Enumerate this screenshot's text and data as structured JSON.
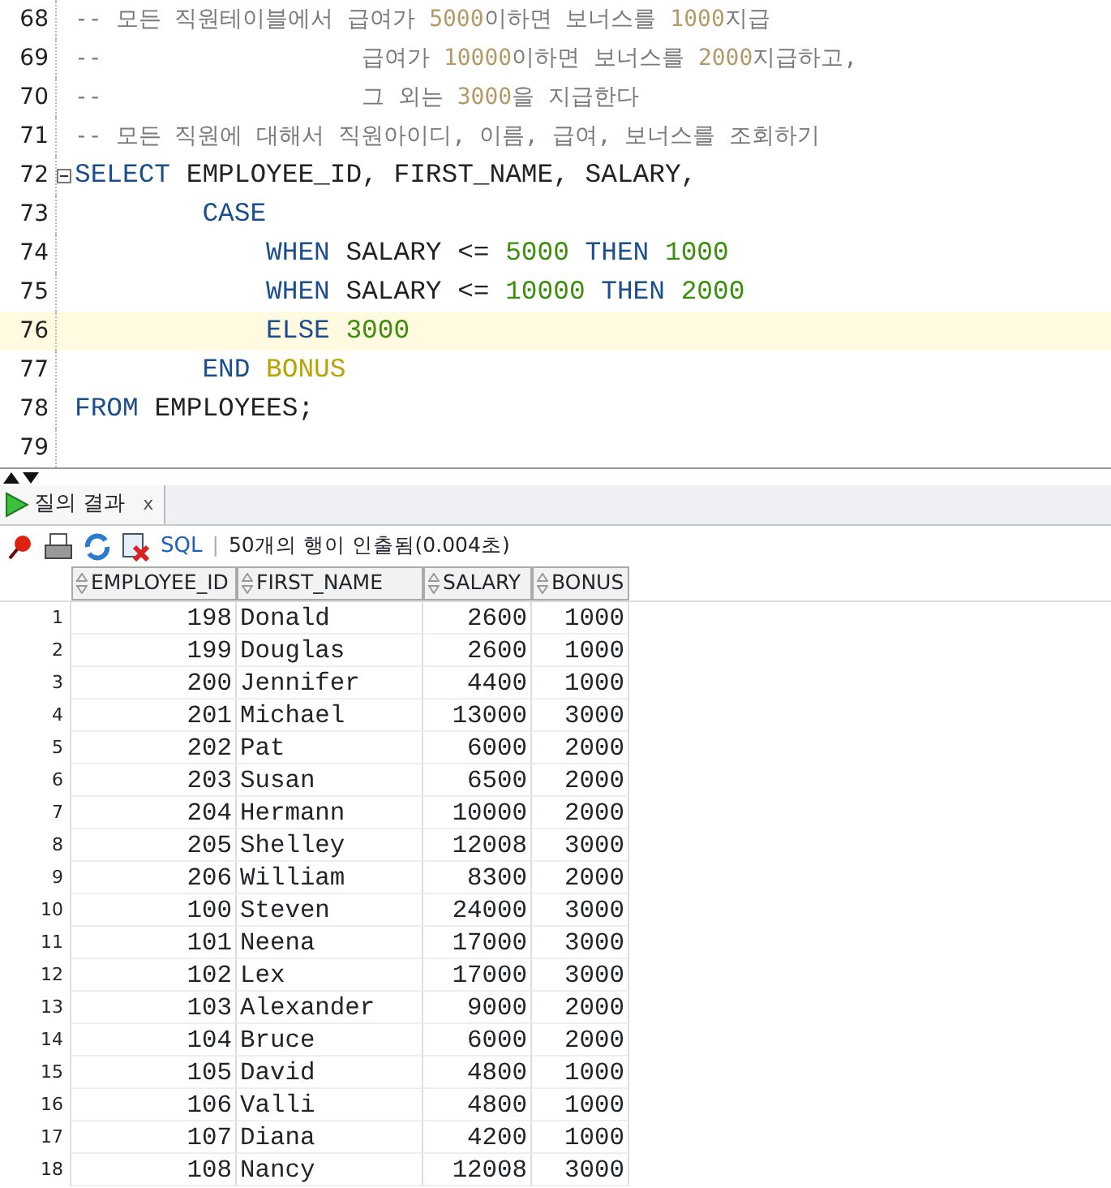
{
  "editor": {
    "lines": [
      {
        "number": "68",
        "current": false,
        "fold": false,
        "tokens": [
          {
            "kind": "comment",
            "text": "-- 모든 직원테이블에서 급여가 "
          },
          {
            "kind": "comment-number",
            "text": "5000"
          },
          {
            "kind": "comment",
            "text": "이하면 보너스를 "
          },
          {
            "kind": "comment-number",
            "text": "1000"
          },
          {
            "kind": "comment",
            "text": "지급"
          }
        ]
      },
      {
        "number": "69",
        "current": false,
        "fold": false,
        "tokens": [
          {
            "kind": "comment",
            "text": "--                   급여가 "
          },
          {
            "kind": "comment-number",
            "text": "10000"
          },
          {
            "kind": "comment",
            "text": "이하면 보너스를 "
          },
          {
            "kind": "comment-number",
            "text": "2000"
          },
          {
            "kind": "comment",
            "text": "지급하고,"
          }
        ]
      },
      {
        "number": "70",
        "current": false,
        "fold": false,
        "tokens": [
          {
            "kind": "comment",
            "text": "--                   그 외는 "
          },
          {
            "kind": "comment-number",
            "text": "3000"
          },
          {
            "kind": "comment",
            "text": "을 지급한다"
          }
        ]
      },
      {
        "number": "71",
        "current": false,
        "fold": false,
        "tokens": [
          {
            "kind": "comment",
            "text": "-- 모든 직원에 대해서 직원아이디, 이름, 급여, 보너스를 조회하기"
          }
        ]
      },
      {
        "number": "72",
        "current": false,
        "fold": true,
        "tokens": [
          {
            "kind": "keyword",
            "text": "SELECT"
          },
          {
            "kind": "plain",
            "text": " EMPLOYEE_ID, FIRST_NAME, SALARY,"
          }
        ]
      },
      {
        "number": "73",
        "current": false,
        "fold": false,
        "tokens": [
          {
            "kind": "keyword",
            "text": "        CASE"
          }
        ]
      },
      {
        "number": "74",
        "current": false,
        "fold": false,
        "tokens": [
          {
            "kind": "keyword",
            "text": "            WHEN"
          },
          {
            "kind": "plain",
            "text": " SALARY <= "
          },
          {
            "kind": "number",
            "text": "5000"
          },
          {
            "kind": "keyword",
            "text": " THEN "
          },
          {
            "kind": "number",
            "text": "1000"
          }
        ]
      },
      {
        "number": "75",
        "current": false,
        "fold": false,
        "tokens": [
          {
            "kind": "keyword",
            "text": "            WHEN"
          },
          {
            "kind": "plain",
            "text": " SALARY <= "
          },
          {
            "kind": "number",
            "text": "10000"
          },
          {
            "kind": "keyword",
            "text": " THEN "
          },
          {
            "kind": "number",
            "text": "2000"
          }
        ]
      },
      {
        "number": "76",
        "current": true,
        "fold": false,
        "tokens": [
          {
            "kind": "keyword",
            "text": "            ELSE "
          },
          {
            "kind": "number",
            "text": "3000"
          }
        ]
      },
      {
        "number": "77",
        "current": false,
        "fold": false,
        "tokens": [
          {
            "kind": "keyword",
            "text": "        END "
          },
          {
            "kind": "alias",
            "text": "BONUS"
          }
        ]
      },
      {
        "number": "78",
        "current": false,
        "fold": false,
        "tokens": [
          {
            "kind": "keyword",
            "text": "FROM"
          },
          {
            "kind": "plain",
            "text": " EMPLOYEES;"
          }
        ]
      },
      {
        "number": "79",
        "current": false,
        "fold": false
      }
    ]
  },
  "results_tab": {
    "label": "질의 결과",
    "close": "x"
  },
  "toolbar": {
    "sql_link": "SQL",
    "separator": "|",
    "status": "50개의 행이 인출됨(0.004초)"
  },
  "table": {
    "columns": [
      "EMPLOYEE_ID",
      "FIRST_NAME",
      "SALARY",
      "BONUS"
    ],
    "rows": [
      {
        "n": "1",
        "cells": [
          "198",
          "Donald",
          "2600",
          "1000"
        ]
      },
      {
        "n": "2",
        "cells": [
          "199",
          "Douglas",
          "2600",
          "1000"
        ]
      },
      {
        "n": "3",
        "cells": [
          "200",
          "Jennifer",
          "4400",
          "1000"
        ]
      },
      {
        "n": "4",
        "cells": [
          "201",
          "Michael",
          "13000",
          "3000"
        ]
      },
      {
        "n": "5",
        "cells": [
          "202",
          "Pat",
          "6000",
          "2000"
        ]
      },
      {
        "n": "6",
        "cells": [
          "203",
          "Susan",
          "6500",
          "2000"
        ]
      },
      {
        "n": "7",
        "cells": [
          "204",
          "Hermann",
          "10000",
          "2000"
        ]
      },
      {
        "n": "8",
        "cells": [
          "205",
          "Shelley",
          "12008",
          "3000"
        ]
      },
      {
        "n": "9",
        "cells": [
          "206",
          "William",
          "8300",
          "2000"
        ]
      },
      {
        "n": "10",
        "cells": [
          "100",
          "Steven",
          "24000",
          "3000"
        ]
      },
      {
        "n": "11",
        "cells": [
          "101",
          "Neena",
          "17000",
          "3000"
        ]
      },
      {
        "n": "12",
        "cells": [
          "102",
          "Lex",
          "17000",
          "3000"
        ]
      },
      {
        "n": "13",
        "cells": [
          "103",
          "Alexander",
          "9000",
          "2000"
        ]
      },
      {
        "n": "14",
        "cells": [
          "104",
          "Bruce",
          "6000",
          "2000"
        ]
      },
      {
        "n": "15",
        "cells": [
          "105",
          "David",
          "4800",
          "1000"
        ]
      },
      {
        "n": "16",
        "cells": [
          "106",
          "Valli",
          "4800",
          "1000"
        ]
      },
      {
        "n": "17",
        "cells": [
          "107",
          "Diana",
          "4200",
          "1000"
        ]
      },
      {
        "n": "18",
        "cells": [
          "108",
          "Nancy",
          "12008",
          "3000"
        ]
      }
    ]
  }
}
